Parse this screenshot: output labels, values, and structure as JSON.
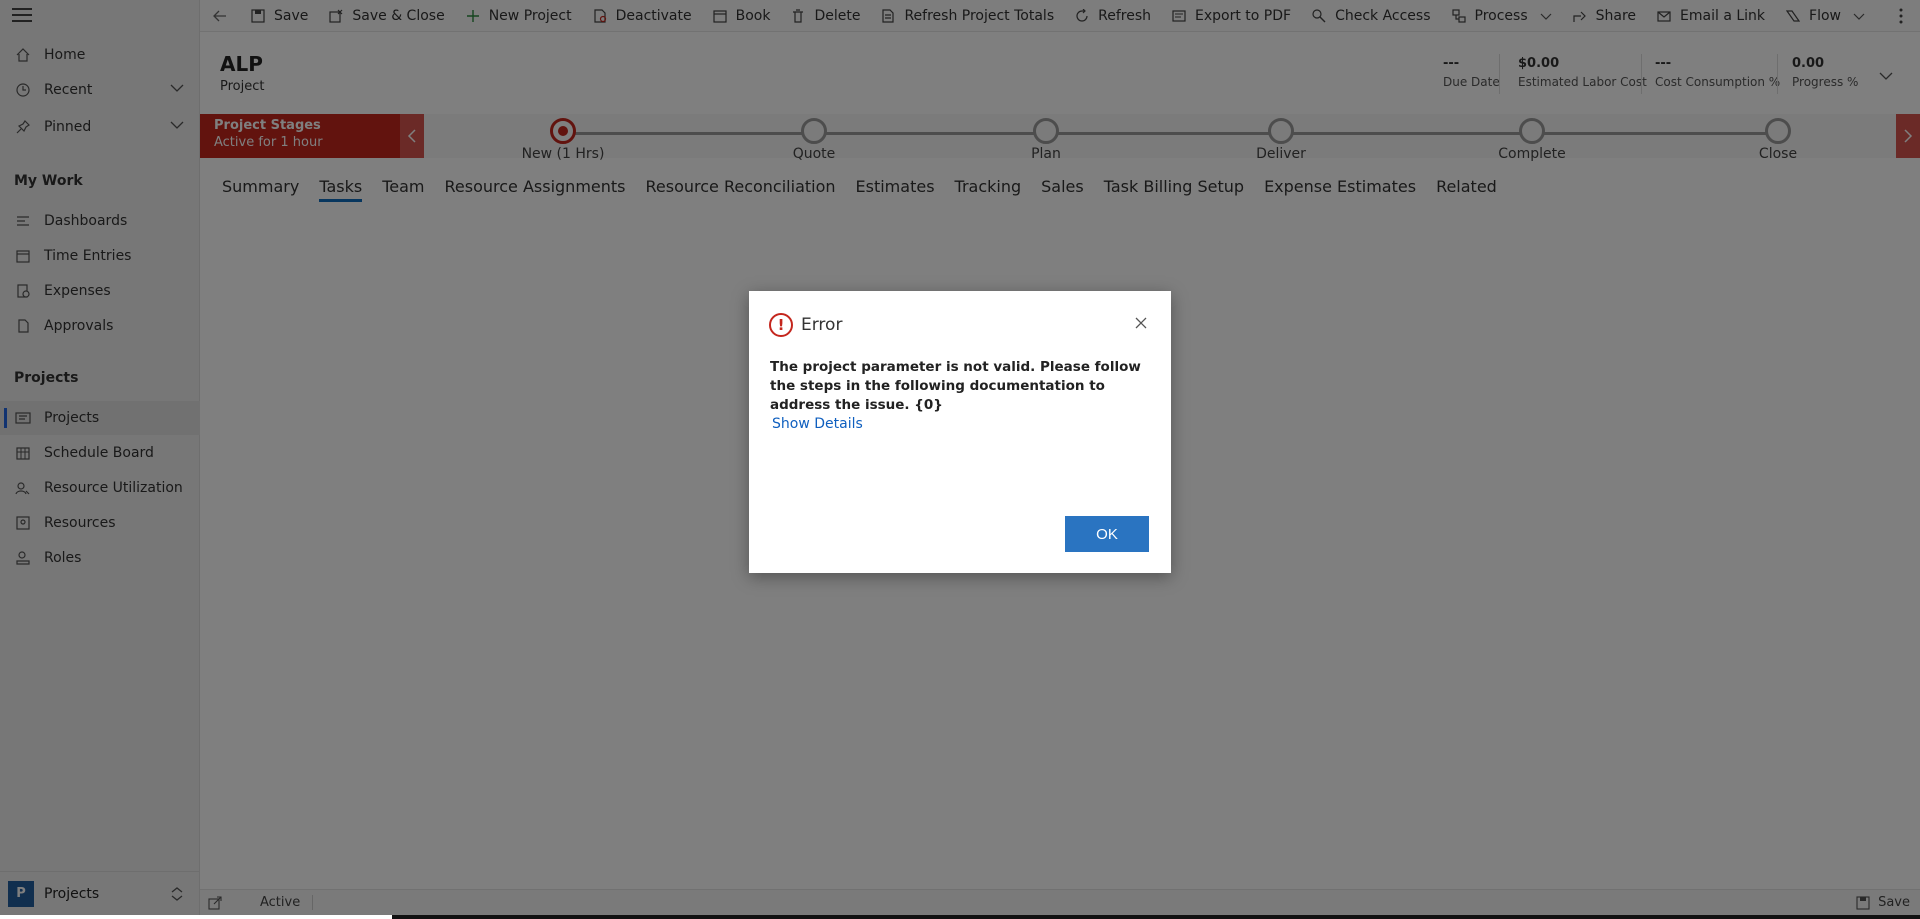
{
  "sidebar": {
    "items": [
      {
        "label": "Home",
        "icon": "home-icon"
      },
      {
        "label": "Recent",
        "icon": "clock-icon"
      },
      {
        "label": "Pinned",
        "icon": "pin-icon"
      }
    ],
    "sections": [
      {
        "title": "My Work",
        "items": [
          "Dashboards",
          "Time Entries",
          "Expenses",
          "Approvals"
        ]
      },
      {
        "title": "Projects",
        "items": [
          "Projects",
          "Schedule Board",
          "Resource Utilization",
          "Resources",
          "Roles"
        ]
      }
    ],
    "selected": "Projects",
    "area": {
      "badge": "P",
      "label": "Projects"
    }
  },
  "toolbar": {
    "commands": [
      "Save",
      "Save & Close",
      "New Project",
      "Deactivate",
      "Book",
      "Delete",
      "Refresh Project Totals",
      "Refresh",
      "Export to PDF",
      "Check Access",
      "Process",
      "Share",
      "Email a Link",
      "Flow"
    ]
  },
  "record": {
    "title": "ALP",
    "type": "Project",
    "fields": [
      {
        "value": "---",
        "label": "Due Date"
      },
      {
        "value": "$0.00",
        "label": "Estimated Labor Cost"
      },
      {
        "value": "---",
        "label": "Cost Consumption %"
      },
      {
        "value": "0.00",
        "label": "Progress %"
      }
    ]
  },
  "stages": {
    "flag_title": "Project Stages",
    "flag_subtitle": "Active for 1 hour",
    "items": [
      "New  (1 Hrs)",
      "Quote",
      "Plan",
      "Deliver",
      "Complete",
      "Close"
    ],
    "active_index": 0
  },
  "tabs": [
    "Summary",
    "Tasks",
    "Team",
    "Resource Assignments",
    "Resource Reconciliation",
    "Estimates",
    "Tracking",
    "Sales",
    "Task Billing Setup",
    "Expense Estimates",
    "Related"
  ],
  "active_tab": "Tasks",
  "statusbar": {
    "status": "Active",
    "save_label": "Save"
  },
  "dialog": {
    "title": "Error",
    "message": "The project parameter is not valid. Please follow the steps in the following documentation to address the issue. {0}",
    "link": "Show Details",
    "ok_label": "OK"
  },
  "colors": {
    "accent": "#c4261d",
    "primary": "#2a74c1",
    "link": "#0f5fbf"
  }
}
